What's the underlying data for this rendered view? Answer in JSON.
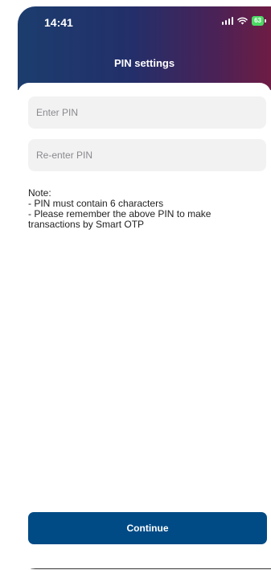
{
  "status_bar": {
    "time": "14:41",
    "battery": "63",
    "icons": [
      "signal-icon",
      "wifi-icon",
      "battery-icon"
    ]
  },
  "header": {
    "title": "PIN settings"
  },
  "form": {
    "pin_placeholder": "Enter PIN",
    "pin_value": "",
    "reenter_placeholder": "Re-enter PIN",
    "reenter_value": ""
  },
  "note": {
    "heading": "Note:",
    "lines": [
      "- PIN must contain 6 characters",
      "- Please remember the above PIN to make transactions by Smart OTP"
    ]
  },
  "actions": {
    "continue_label": "Continue"
  },
  "colors": {
    "header_gradient": [
      "#1c3d6e",
      "#232f6a",
      "#4a2257",
      "#6e1c44"
    ],
    "button": "#004b86",
    "field_bg": "#f2f2f3",
    "battery": "#4cd964"
  }
}
